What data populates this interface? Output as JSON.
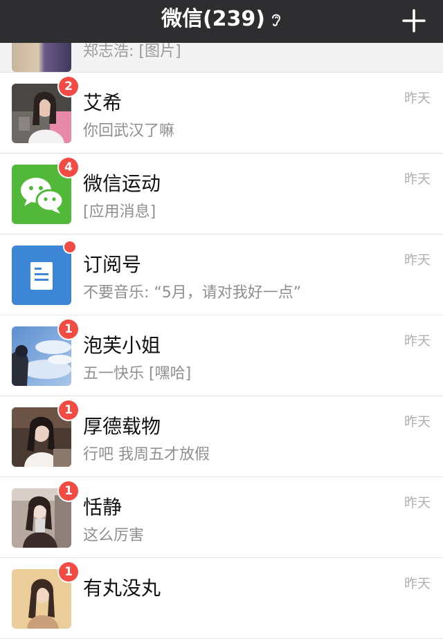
{
  "header": {
    "title": "微信(239)",
    "plus_icon": "plus-icon",
    "ear_icon": "ear-icon"
  },
  "partial_row": {
    "preview": "郑志浩: [图片]"
  },
  "chats": [
    {
      "name": "艾希",
      "preview": "你回武汉了嘛",
      "time": "昨天",
      "badge": "2"
    },
    {
      "name": "微信运动",
      "preview": "[应用消息]",
      "time": "昨天",
      "badge": "4",
      "icon": "wechat-logo-icon"
    },
    {
      "name": "订阅号",
      "preview": "不要音乐: “5月，请对我好一点”",
      "time": "昨天",
      "badge_dot": true,
      "icon": "document-icon"
    },
    {
      "name": "泡芙小姐",
      "preview": "五一快乐 [嘿哈]",
      "time": "昨天",
      "badge": "1"
    },
    {
      "name": "厚德载物",
      "preview": "行吧 我周五才放假",
      "time": "昨天",
      "badge": "1"
    },
    {
      "name": "恬静",
      "preview": "这么厉害",
      "time": "昨天",
      "badge": "1"
    },
    {
      "name": "有丸没丸",
      "preview": "",
      "time": "昨天",
      "badge": "1"
    }
  ],
  "colors": {
    "header_bg": "#2e2e30",
    "badge": "#f24b43",
    "wechat_green": "#52b83a",
    "subscription_blue": "#3d86d6"
  }
}
